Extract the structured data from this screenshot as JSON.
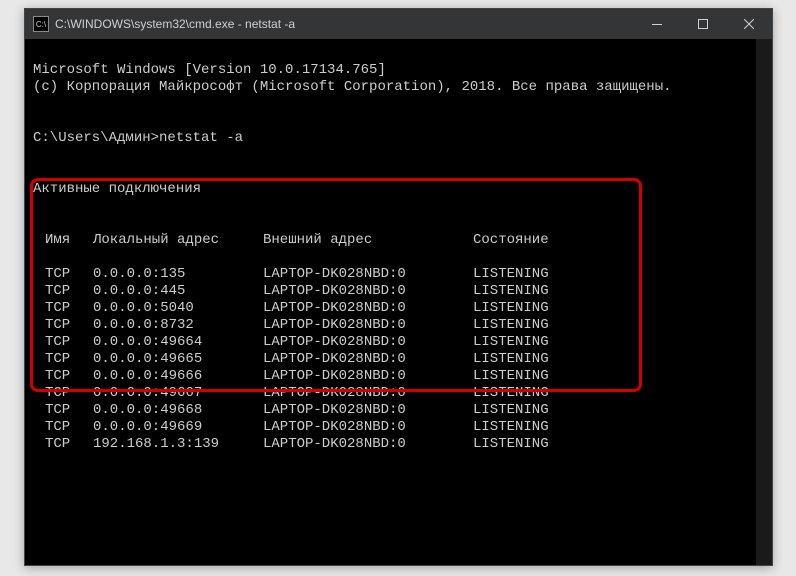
{
  "window": {
    "title": "C:\\WINDOWS\\system32\\cmd.exe - netstat  -a"
  },
  "terminal": {
    "line1": "Microsoft Windows [Version 10.0.17134.765]",
    "line2": "(c) Корпорация Майкрософт (Microsoft Corporation), 2018. Все права защищены.",
    "prompt": "C:\\Users\\Админ>",
    "command": "netstat -a",
    "heading": "Активные подключения",
    "columns": {
      "proto": "Имя",
      "local": "Локальный адрес",
      "foreign": "Внешний адрес",
      "state": "Состояние"
    },
    "rows": [
      {
        "proto": "TCP",
        "local": "0.0.0.0:135",
        "foreign": "LAPTOP-DK028NBD:0",
        "state": "LISTENING"
      },
      {
        "proto": "TCP",
        "local": "0.0.0.0:445",
        "foreign": "LAPTOP-DK028NBD:0",
        "state": "LISTENING"
      },
      {
        "proto": "TCP",
        "local": "0.0.0.0:5040",
        "foreign": "LAPTOP-DK028NBD:0",
        "state": "LISTENING"
      },
      {
        "proto": "TCP",
        "local": "0.0.0.0:8732",
        "foreign": "LAPTOP-DK028NBD:0",
        "state": "LISTENING"
      },
      {
        "proto": "TCP",
        "local": "0.0.0.0:49664",
        "foreign": "LAPTOP-DK028NBD:0",
        "state": "LISTENING"
      },
      {
        "proto": "TCP",
        "local": "0.0.0.0:49665",
        "foreign": "LAPTOP-DK028NBD:0",
        "state": "LISTENING"
      },
      {
        "proto": "TCP",
        "local": "0.0.0.0:49666",
        "foreign": "LAPTOP-DK028NBD:0",
        "state": "LISTENING"
      },
      {
        "proto": "TCP",
        "local": "0.0.0.0:49667",
        "foreign": "LAPTOP-DK028NBD:0",
        "state": "LISTENING"
      },
      {
        "proto": "TCP",
        "local": "0.0.0.0:49668",
        "foreign": "LAPTOP-DK028NBD:0",
        "state": "LISTENING"
      },
      {
        "proto": "TCP",
        "local": "0.0.0.0:49669",
        "foreign": "LAPTOP-DK028NBD:0",
        "state": "LISTENING"
      },
      {
        "proto": "TCP",
        "local": "192.168.1.3:139",
        "foreign": "LAPTOP-DK028NBD:0",
        "state": "LISTENING"
      }
    ]
  }
}
